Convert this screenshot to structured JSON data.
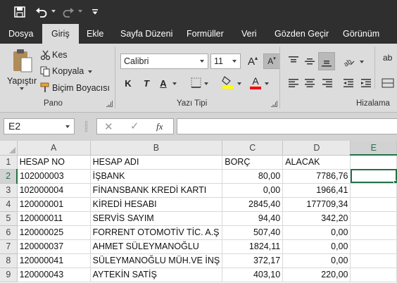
{
  "quick_access": {
    "icons": [
      "save-icon",
      "undo-icon",
      "redo-icon",
      "customize-icon"
    ]
  },
  "tabs": [
    {
      "label": "Dosya"
    },
    {
      "label": "Giriş"
    },
    {
      "label": "Ekle"
    },
    {
      "label": "Sayfa Düzeni"
    },
    {
      "label": "Formüller"
    },
    {
      "label": "Veri"
    },
    {
      "label": "Gözden Geçir"
    },
    {
      "label": "Görünüm"
    }
  ],
  "ribbon": {
    "clipboard": {
      "paste_label": "Yapıştır",
      "cut_label": "Kes",
      "copy_label": "Kopyala",
      "format_painter_label": "Biçim Boyacısı",
      "group_label": "Pano"
    },
    "font": {
      "font_name": "Calibri",
      "font_size": "11",
      "bold": "K",
      "italic": "T",
      "underline": "A",
      "font_color_letter": "A",
      "grow_letter": "A",
      "shrink_letter": "A",
      "group_label": "Yazı Tipi",
      "fill_color": "#ffff00",
      "font_color": "#ff0000"
    },
    "alignment": {
      "wrap_label": "ab",
      "group_label": "Hizalama"
    }
  },
  "formula_bar": {
    "name_box": "E2",
    "fx_label": "fx",
    "formula": ""
  },
  "sheet": {
    "columns": [
      "A",
      "B",
      "C",
      "D",
      "E"
    ],
    "selected_column": "E",
    "selected_row": "2",
    "rows": [
      {
        "num": "1",
        "cells": [
          "HESAP NO",
          "HESAP ADI",
          "BORÇ",
          "ALACAK",
          ""
        ]
      },
      {
        "num": "2",
        "cells": [
          "102000003",
          "İŞBANK",
          "80,00",
          "7786,76",
          ""
        ]
      },
      {
        "num": "3",
        "cells": [
          "102000004",
          "FİNANSBANK KREDİ KARTI",
          "0,00",
          "1966,41",
          ""
        ]
      },
      {
        "num": "4",
        "cells": [
          "120000001",
          "KİREDİ  HESABI",
          "2845,40",
          "177709,34",
          ""
        ]
      },
      {
        "num": "5",
        "cells": [
          "120000011",
          "SERVİS SAYIM",
          "94,40",
          "342,20",
          ""
        ]
      },
      {
        "num": "6",
        "cells": [
          "120000025",
          "FORRENT OTOMOTİV TİC. A.Ş",
          "507,40",
          "0,00",
          ""
        ]
      },
      {
        "num": "7",
        "cells": [
          "120000037",
          "AHMET SÜLEYMANOĞLU",
          "1824,11",
          "0,00",
          ""
        ]
      },
      {
        "num": "8",
        "cells": [
          "120000041",
          "SÜLEYMANOĞLU MÜH.VE İNŞ",
          "372,17",
          "0,00",
          ""
        ]
      },
      {
        "num": "9",
        "cells": [
          "120000043",
          "AYTEKİN SATİŞ",
          "403,10",
          "220,00",
          ""
        ]
      }
    ]
  },
  "colors": {
    "excel_green": "#217346",
    "title_bar": "#2f2f2f",
    "ribbon": "#dcdcdc"
  }
}
